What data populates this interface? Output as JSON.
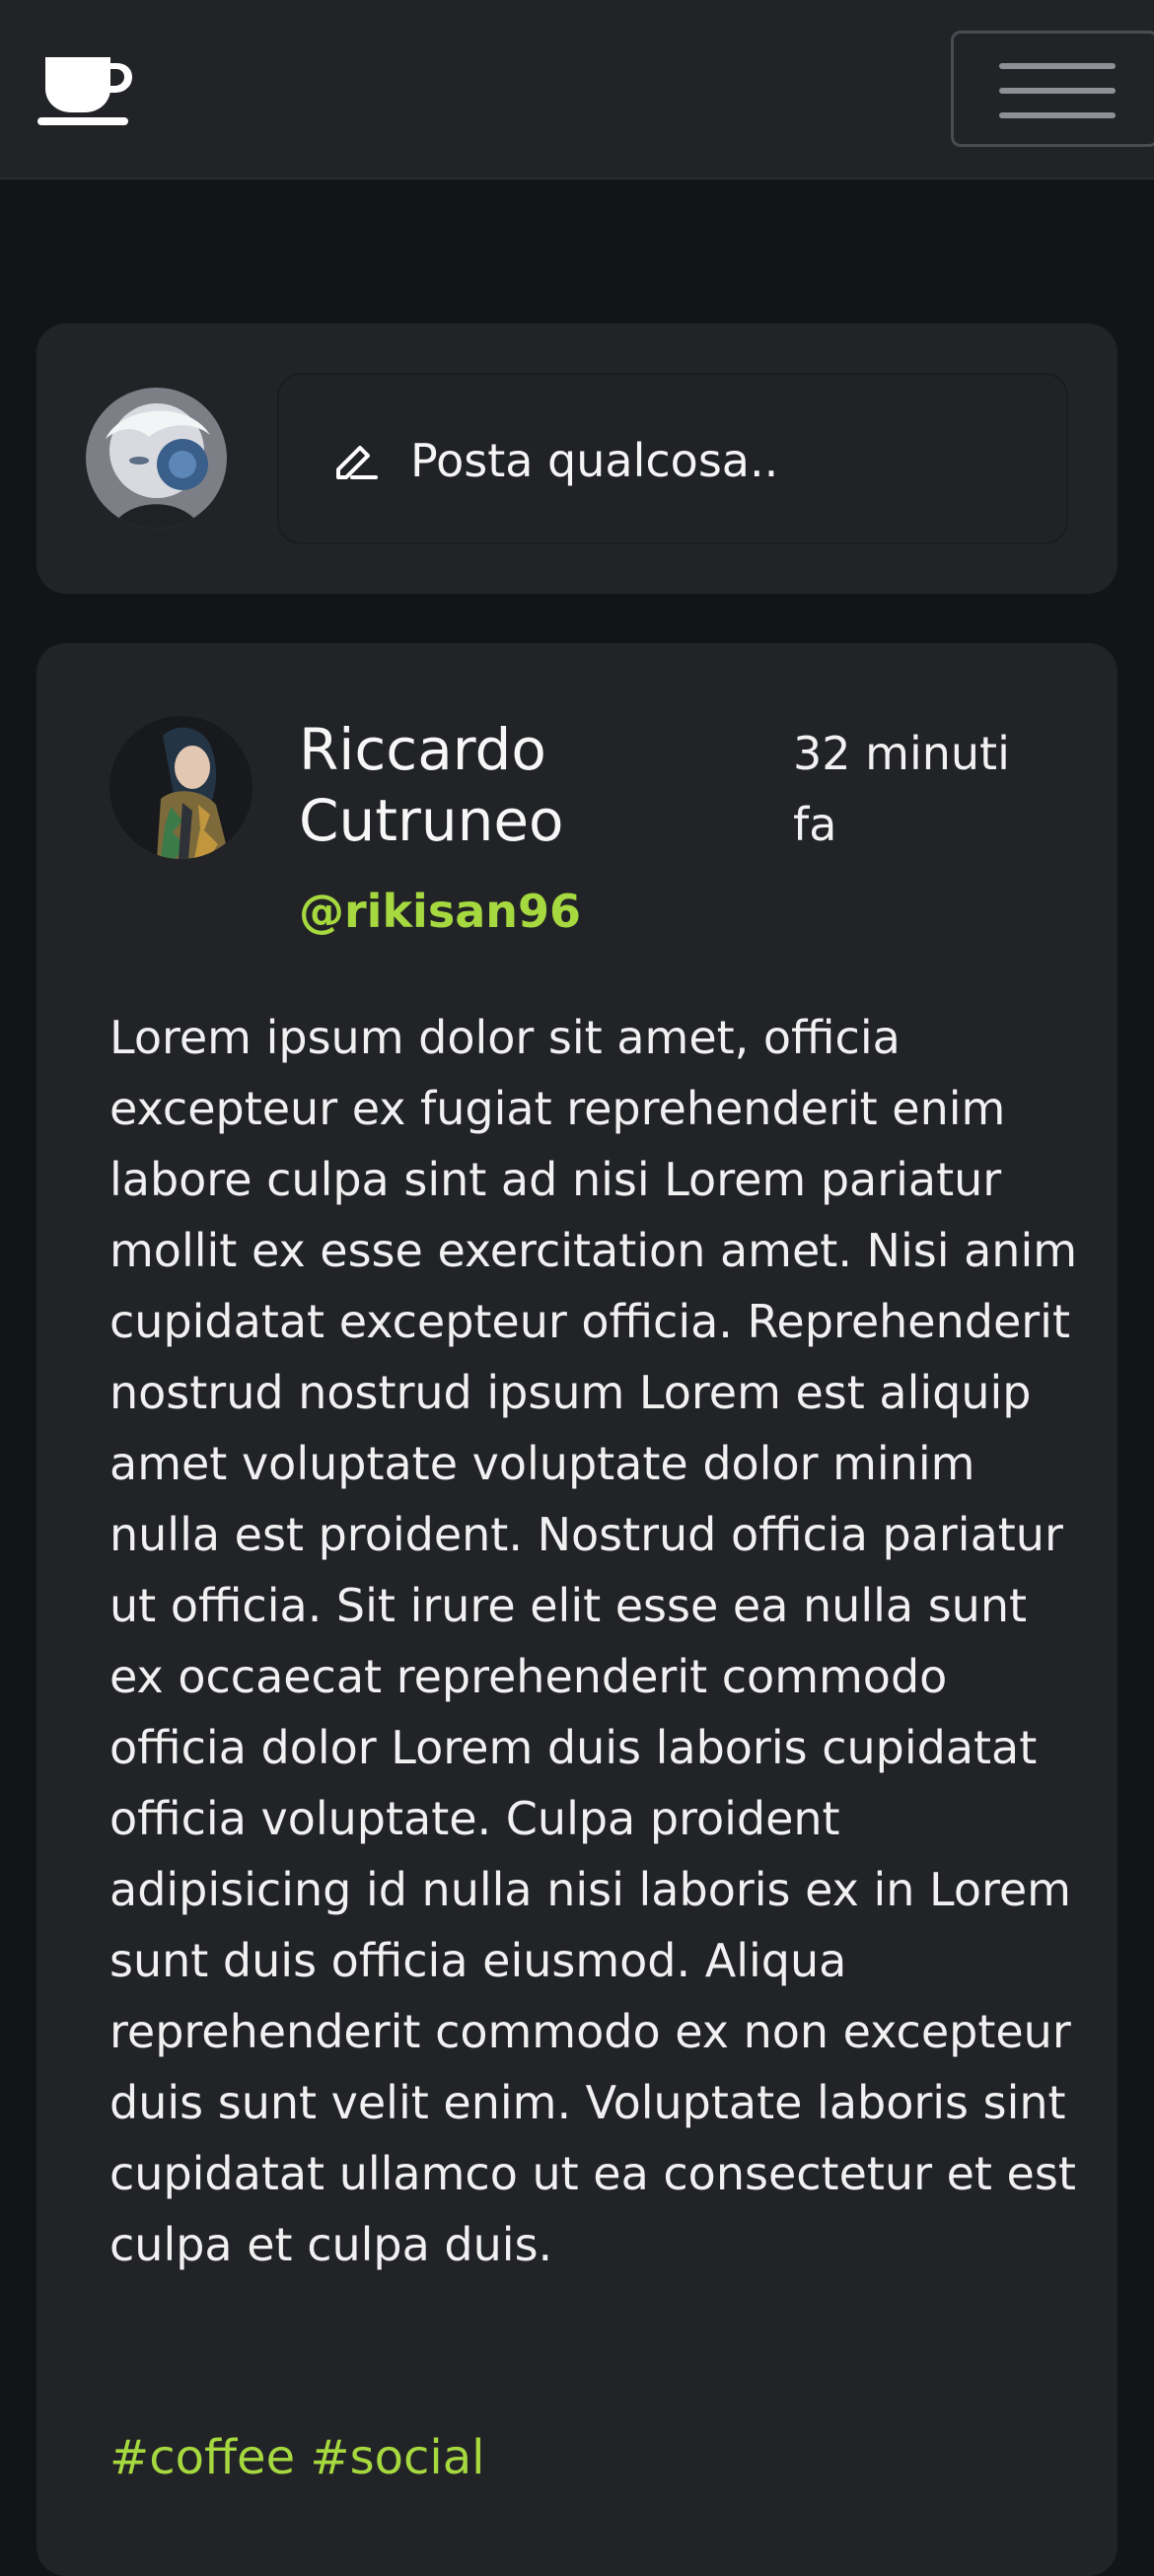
{
  "navbar": {
    "brand_icon": "coffee-cup-icon",
    "menu_icon": "hamburger-menu-icon"
  },
  "composer": {
    "avatar_icon": "user-avatar",
    "pen_icon": "pencil-icon",
    "placeholder": "Posta qualcosa.."
  },
  "post": {
    "author_name": "Riccardo Cutruneo",
    "time": "32 minuti fa",
    "handle": "@rikisan96",
    "body": "Lorem ipsum dolor sit amet, officia excepteur ex fugiat reprehenderit enim labore culpa sint ad nisi Lorem pariatur mollit ex esse exercitation amet. Nisi anim cupidatat excepteur officia. Reprehenderit nostrud nostrud ipsum Lorem est aliquip amet voluptate voluptate dolor minim nulla est proident. Nostrud officia pariatur ut officia. Sit irure elit esse ea nulla sunt ex occaecat reprehenderit commodo officia dolor Lorem duis laboris cupidatat officia voluptate. Culpa proident adipisicing id nulla nisi laboris ex in Lorem sunt duis officia eiusmod. Aliqua reprehenderit commodo ex non excepteur duis sunt velit enim. Voluptate laboris sint cupidatat ullamco ut ea consectetur et est culpa et culpa duis.",
    "tags": "#coffee #social"
  },
  "colors": {
    "accent": "#a6d83f",
    "card": "#222327",
    "background": "#131416"
  }
}
